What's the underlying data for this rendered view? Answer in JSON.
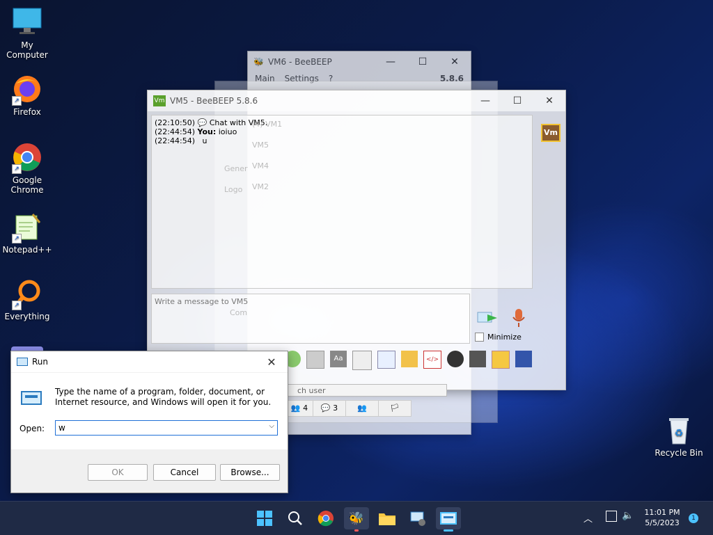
{
  "desktop": {
    "icons": [
      {
        "label": "My Computer"
      },
      {
        "label": "Firefox"
      },
      {
        "label_line1": "Google",
        "label_line2": "Chrome"
      },
      {
        "label": "Notepad++"
      },
      {
        "label": "Everything"
      },
      {
        "label": "Recycle Bin"
      }
    ]
  },
  "vm6": {
    "title": "VM6 - BeeBEEP",
    "menu": [
      "Main",
      "Settings",
      "?"
    ],
    "version": "5.8.6",
    "users": [
      "(4) VM1",
      "VM5",
      "VM4",
      "VM2"
    ],
    "search_placeholder": "ch user",
    "tabs": [
      "4",
      "3"
    ]
  },
  "vm5": {
    "title": "VM5 - BeeBEEP 5.8.6",
    "messages": [
      {
        "time": "(22:10:50)",
        "text": "Chat with VM5."
      },
      {
        "time": "(22:44:54)",
        "sender": "You:",
        "text": "ioiuo"
      },
      {
        "time": "(22:44:54)",
        "text": "u"
      }
    ],
    "input_placeholder": "Write a message to VM5",
    "minimize_label": "Minimize",
    "avatar_text": "Vm",
    "sidebar_labels": [
      "Gener",
      "Logo",
      "Com"
    ]
  },
  "run": {
    "title": "Run",
    "description": "Type the name of a program, folder, document, or Internet resource, and Windows will open it for you.",
    "open_label": "Open:",
    "open_value": "w",
    "ok_label": "OK",
    "cancel_label": "Cancel",
    "browse_label": "Browse..."
  },
  "taskbar": {
    "time": "11:01 PM",
    "date": "5/5/2023",
    "notification_count": "1"
  }
}
